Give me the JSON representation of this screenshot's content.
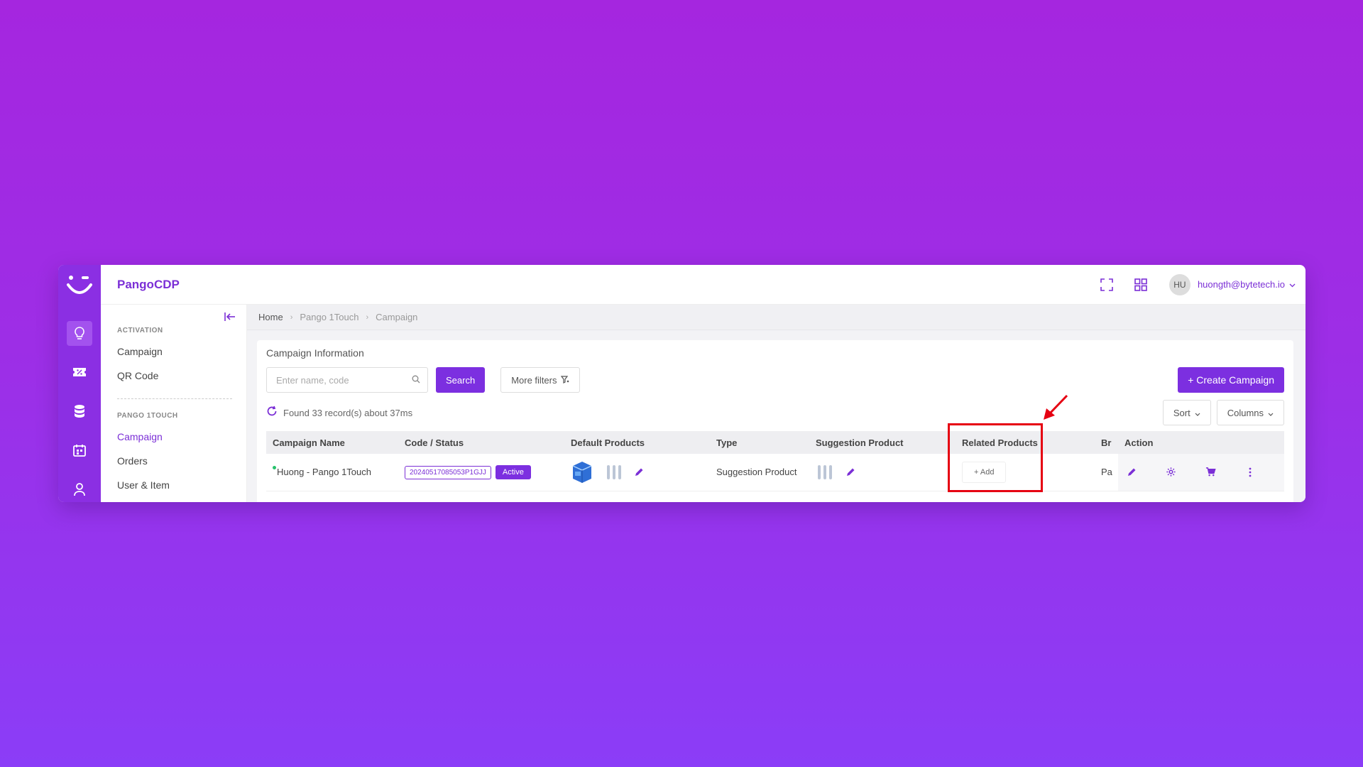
{
  "app": {
    "brand": "PangoCDP"
  },
  "user": {
    "initials": "HU",
    "email": "huongth@bytetech.io"
  },
  "sidebar": {
    "sections": [
      {
        "title": "ACTIVATION",
        "items": [
          "Campaign",
          "QR Code"
        ]
      },
      {
        "title": "PANGO 1TOUCH",
        "items": [
          "Campaign",
          "Orders",
          "User & Item"
        ]
      }
    ]
  },
  "breadcrumb": [
    "Home",
    "Pango 1Touch",
    "Campaign"
  ],
  "card": {
    "title": "Campaign Information",
    "search_placeholder": "Enter name, code",
    "search_button": "Search",
    "more_filters": "More filters",
    "create_button": "+ Create Campaign",
    "found_text": "Found 33 record(s) about 37ms",
    "sort_button": "Sort",
    "columns_button": "Columns"
  },
  "table": {
    "headers": [
      "Campaign Name",
      "Code / Status",
      "Default Products",
      "Type",
      "Suggestion Product",
      "Related Products",
      "Br",
      "Action"
    ],
    "rows": [
      {
        "name": "Huong - Pango 1Touch",
        "code": "20240517085053P1GJJ",
        "status": "Active",
        "type": "Suggestion Product",
        "related_add": "+ Add",
        "brand_partial": "Pa"
      }
    ]
  },
  "colors": {
    "accent": "#7c2fe0",
    "rail": "#8b2fe3",
    "annotation": "#e60012",
    "status_dot": "#27c26c"
  }
}
